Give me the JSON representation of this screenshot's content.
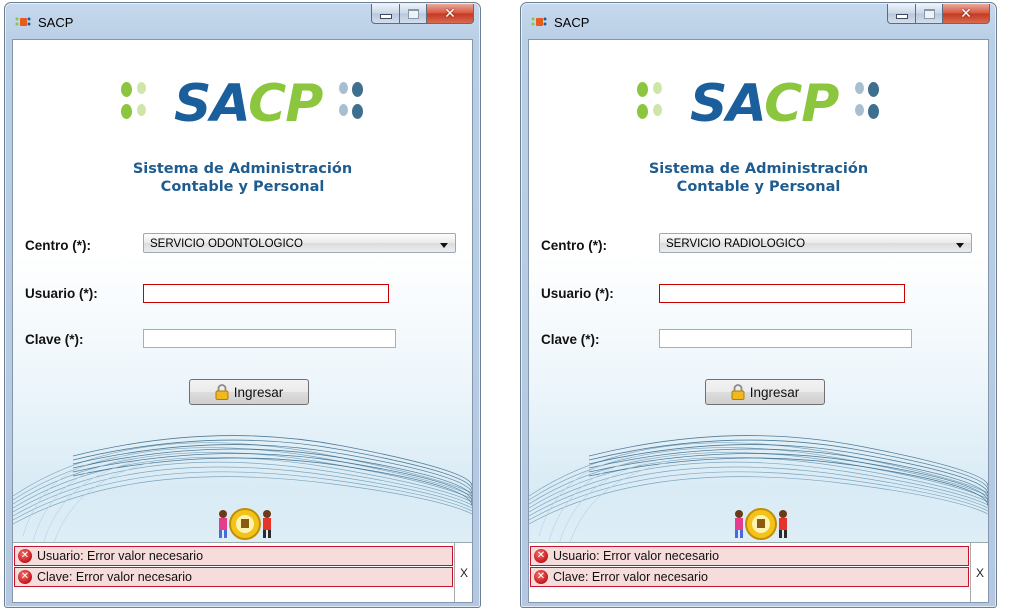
{
  "windows": [
    {
      "title": "SACP",
      "logo": {
        "part1": "SA",
        "part2": "CP"
      },
      "subtitle_line1": "Sistema de Administración",
      "subtitle_line2": "Contable y Personal",
      "centro_label": "Centro (*):",
      "centro_value": "SERVICIO ODONTOLOGICO",
      "usuario_label": "Usuario (*):",
      "usuario_value": "",
      "clave_label": "Clave (*):",
      "clave_value": "",
      "login_button": "Ingresar",
      "messages": [
        "Usuario: Error valor necesario",
        "Clave: Error valor necesario"
      ],
      "close_messages": "X"
    },
    {
      "title": "SACP",
      "logo": {
        "part1": "SA",
        "part2": "CP"
      },
      "subtitle_line1": "Sistema de Administración",
      "subtitle_line2": "Contable y Personal",
      "centro_label": "Centro (*):",
      "centro_value": "SERVICIO RADIOLOGICO",
      "usuario_label": "Usuario (*):",
      "usuario_value": "",
      "clave_label": "Clave (*):",
      "clave_value": "",
      "login_button": "Ingresar",
      "messages": [
        "Usuario: Error valor necesario",
        "Clave: Error valor necesario"
      ],
      "close_messages": "X"
    }
  ],
  "colors": {
    "brand_blue": "#1a5f9c",
    "brand_green": "#8cc63f",
    "error_border": "#c80000",
    "error_bg": "#f7dcdc"
  },
  "icons": [
    "app-icon",
    "minimize-icon",
    "maximize-icon",
    "close-icon",
    "dropdown-arrow-icon",
    "lock-icon",
    "error-icon"
  ]
}
